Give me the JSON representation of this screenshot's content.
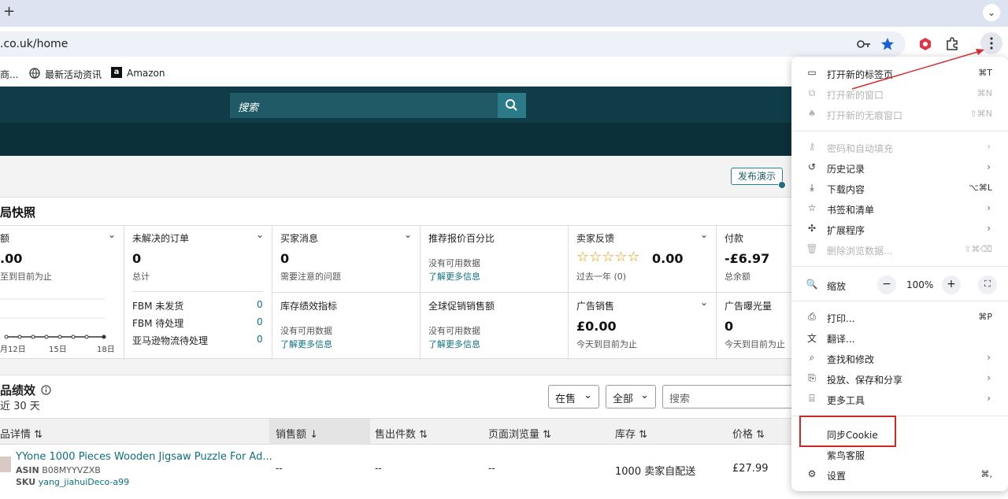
{
  "browser": {
    "new_tab": "+",
    "tab_menu": "⌄",
    "url": ".co.uk/home",
    "bookmarks": [
      {
        "label": "商..."
      },
      {
        "label": "最新活动资讯"
      },
      {
        "label": "Amazon"
      }
    ]
  },
  "seller": {
    "search_placeholder": "搜索",
    "publish_demo": "发布演示",
    "snapshot_title": "局快照",
    "cards": {
      "sales": {
        "title": "额",
        "value": ".00",
        "sub": "至到目前为止",
        "ticks": [
          "月12日",
          "15日",
          "18日"
        ]
      },
      "orders": {
        "title": "未解决的订单",
        "value": "0",
        "sub": "总计",
        "rows": [
          {
            "label": "FBM 未发货",
            "count": "0"
          },
          {
            "label": "FBM 待处理",
            "count": "0"
          },
          {
            "label": "亚马逊物流待处理",
            "count": "0"
          }
        ]
      },
      "buyer_messages": {
        "title": "买家消息",
        "value": "0",
        "sub": "需要注意的问题"
      },
      "featured_offer": {
        "title": "推荐报价百分比",
        "nodata": "没有可用数据",
        "link": "了解更多信息"
      },
      "feedback": {
        "title": "卖家反馈",
        "stars": "☆☆☆☆☆",
        "value": "0.00",
        "sub": "过去一年 (0)"
      },
      "payments": {
        "title": "付款",
        "value": "-£6.97",
        "sub": "总余额"
      },
      "inventory": {
        "title": "库存绩效指标",
        "nodata": "没有可用数据",
        "link": "了解更多信息"
      },
      "global_promo": {
        "title": "全球促销销售额",
        "nodata": "没有可用数据",
        "link": "了解更多信息"
      },
      "ad_sales": {
        "title": "广告销售",
        "value": "£0.00",
        "sub": "今天到目前为止"
      },
      "ad_impressions": {
        "title": "广告曝光量",
        "value": "0",
        "sub": "今天到目前为止"
      }
    },
    "performance": {
      "title": "品绩效",
      "subtitle": "近 30 天",
      "filter_status": "在售",
      "filter_all": "全部",
      "search_placeholder": "搜索",
      "columns": [
        "品详情",
        "销售额",
        "售出件数",
        "页面浏览量",
        "库存",
        "价格"
      ],
      "row": {
        "title": "YYone 1000 Pieces Wooden Jigsaw Puzzle For Ad...",
        "asin_label": "ASIN",
        "asin": "B08MYYVZXB",
        "sku_label": "SKU",
        "sku": "yang_jiahuiDeco-a99",
        "sales": "--",
        "units": "--",
        "views": "--",
        "inventory": "1000 卖家自配送",
        "price": "£27.99"
      }
    }
  },
  "menu": {
    "items": [
      {
        "label": "打开新的标签页",
        "shortcut": "⌘T"
      },
      {
        "label": "打开新的窗口",
        "shortcut": "⌘N"
      },
      {
        "label": "打开新的无痕窗口",
        "shortcut": "⇧⌘N"
      },
      {
        "label": "密码和自动填充"
      },
      {
        "label": "历史记录"
      },
      {
        "label": "下载内容",
        "shortcut": "⌥⌘L"
      },
      {
        "label": "书签和清单"
      },
      {
        "label": "扩展程序"
      },
      {
        "label": "删除浏览数据...",
        "shortcut": "⇧⌘⌫"
      },
      {
        "label": "缩放",
        "zoom": "100%",
        "minus": "−",
        "plus": "+"
      },
      {
        "label": "打印...",
        "shortcut": "⌘P"
      },
      {
        "label": "翻译..."
      },
      {
        "label": "查找和修改"
      },
      {
        "label": "投放、保存和分享"
      },
      {
        "label": "更多工具"
      },
      {
        "label": "同步Cookie"
      },
      {
        "label": "紫鸟客服"
      },
      {
        "label": "设置",
        "shortcut": "⌘,"
      }
    ]
  }
}
